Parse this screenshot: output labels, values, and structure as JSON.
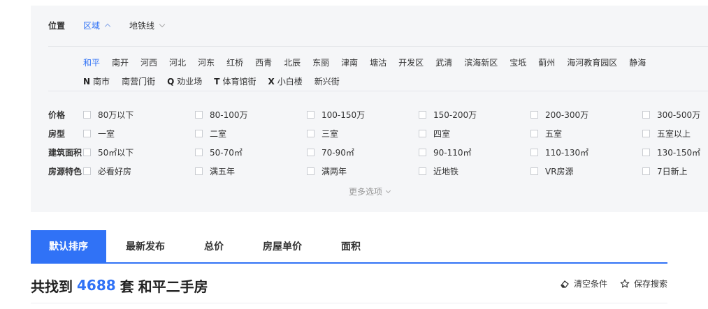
{
  "position": {
    "label": "位置",
    "tabs": [
      {
        "label": "区域",
        "active": true
      },
      {
        "label": "地铁线",
        "active": false
      }
    ]
  },
  "districts": {
    "line1": [
      "和平",
      "南开",
      "河西",
      "河北",
      "河东",
      "红桥",
      "西青",
      "北辰",
      "东丽",
      "津南",
      "塘沽",
      "开发区",
      "武清",
      "滨海新区",
      "宝坻",
      "蓟州",
      "海河教育园区",
      "静海"
    ],
    "line2": [
      {
        "letter": "N",
        "name": "南市"
      },
      {
        "letter": "",
        "name": "南营门街"
      },
      {
        "letter": "Q",
        "name": "劝业场"
      },
      {
        "letter": "T",
        "name": "体育馆街"
      },
      {
        "letter": "X",
        "name": "小白楼"
      },
      {
        "letter": "",
        "name": "新兴街"
      }
    ],
    "active": "和平"
  },
  "filters": [
    {
      "label": "价格",
      "options": [
        "80万以下",
        "80-100万",
        "100-150万",
        "150-200万",
        "200-300万",
        "300-500万"
      ]
    },
    {
      "label": "房型",
      "options": [
        "一室",
        "二室",
        "三室",
        "四室",
        "五室",
        "五室以上"
      ]
    },
    {
      "label": "建筑面积",
      "options": [
        "50㎡以下",
        "50-70㎡",
        "70-90㎡",
        "90-110㎡",
        "110-130㎡",
        "130-150㎡"
      ]
    },
    {
      "label": "房源特色",
      "options": [
        "必看好房",
        "满五年",
        "满两年",
        "近地铁",
        "VR房源",
        "7日新上"
      ]
    }
  ],
  "more_options": "更多选项",
  "sort_tabs": [
    {
      "label": "默认排序",
      "active": true
    },
    {
      "label": "最新发布",
      "active": false
    },
    {
      "label": "总价",
      "active": false
    },
    {
      "label": "房屋单价",
      "active": false
    },
    {
      "label": "面积",
      "active": false
    }
  ],
  "result": {
    "prefix": "共找到",
    "count": "4688",
    "unit": "套",
    "title": "和平二手房"
  },
  "actions": {
    "clear": "清空条件",
    "save": "保存搜索"
  },
  "colors": {
    "accent": "#3072f6",
    "panel_bg": "#f5f6f8"
  }
}
